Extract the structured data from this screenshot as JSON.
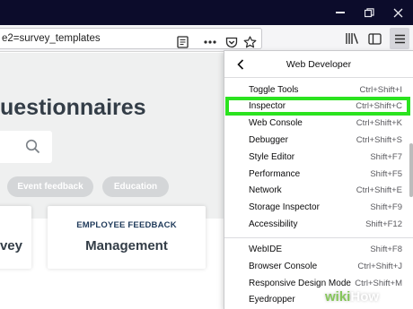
{
  "browser": {
    "url_text": "e2=survey_templates",
    "icons": {
      "reader": "reader-view-icon",
      "more": "more-icon",
      "pocket": "pocket-icon",
      "bookmark": "bookmark-star-icon",
      "library": "library-icon",
      "sidebar": "sidebar-icon",
      "menu": "hamburger-menu-icon"
    },
    "window_controls": [
      "minimize-icon",
      "restore-icon",
      "close-icon"
    ],
    "colors": {
      "titlebar": "#0c0c2b",
      "toolbar": "#f5f5f7"
    }
  },
  "page": {
    "title": "uestionnaires",
    "pills": [
      "Event feedback",
      "Education"
    ],
    "cards": [
      {
        "category": "",
        "title": "vey"
      },
      {
        "category": "EMPLOYEE FEEDBACK",
        "title": "Management"
      }
    ],
    "colors": {
      "hero_bg": "#eff0f0",
      "heading": "#333d47",
      "pill_bg": "#d4d6d8"
    }
  },
  "menu": {
    "title": "Web Developer",
    "items": [
      {
        "label": "Toggle Tools",
        "shortcut": "Ctrl+Shift+I"
      },
      {
        "label": "Inspector",
        "shortcut": "Ctrl+Shift+C",
        "highlighted": true
      },
      {
        "label": "Web Console",
        "shortcut": "Ctrl+Shift+K"
      },
      {
        "label": "Debugger",
        "shortcut": "Ctrl+Shift+S"
      },
      {
        "label": "Style Editor",
        "shortcut": "Shift+F7"
      },
      {
        "label": "Performance",
        "shortcut": "Shift+F5"
      },
      {
        "label": "Network",
        "shortcut": "Ctrl+Shift+E"
      },
      {
        "label": "Storage Inspector",
        "shortcut": "Shift+F9"
      },
      {
        "label": "Accessibility",
        "shortcut": "Shift+F12"
      },
      {
        "label": "WebIDE",
        "shortcut": "Shift+F8"
      },
      {
        "label": "Browser Console",
        "shortcut": "Ctrl+Shift+J"
      },
      {
        "label": "Responsive Design Mode",
        "shortcut": "Ctrl+Shift+M"
      },
      {
        "label": "Eyedropper",
        "shortcut": ""
      }
    ],
    "colors": {
      "highlight_border": "#2be31f"
    }
  },
  "watermark": {
    "prefix": "wiki",
    "suffix": "How"
  }
}
